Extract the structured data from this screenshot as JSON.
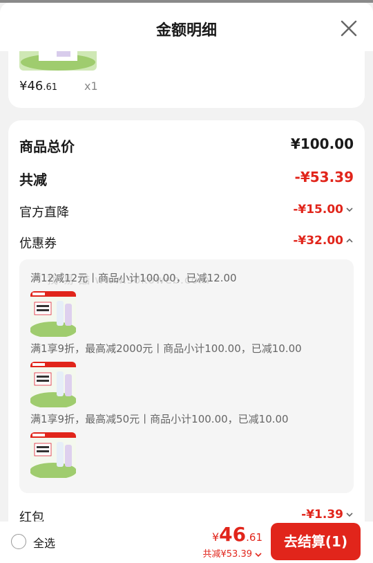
{
  "header": {
    "title": "金额明细"
  },
  "item": {
    "price_symbol": "¥",
    "price_int": "46",
    "price_dec": ".61",
    "qty": "x1"
  },
  "summary": {
    "goods_total_label": "商品总价",
    "goods_total_value": "¥100.00",
    "reduce_label": "共减",
    "reduce_value": "-¥53.39",
    "official_label": "官方直降",
    "official_value": "-¥15.00",
    "coupon_label": "优惠券",
    "coupon_value": "-¥32.00",
    "hongbao_label": "红包",
    "hongbao_value": "-¥1.39"
  },
  "coupons": [
    {
      "text": "满12减12元丨商品小计100.00，已减12.00"
    },
    {
      "text": "满1享9折，最高减2000元丨商品小计100.00，已减10.00"
    },
    {
      "text": "满1享9折，最高减50元丨商品小计100.00，已减10.00"
    }
  ],
  "watermark": "找 易 酷 www.sokoweb.com",
  "footer": {
    "select_all": "全选",
    "total_symbol": "¥",
    "total_int": "46",
    "total_dec": ".61",
    "reduced_text": "共减¥53.39",
    "checkout_label": "去结算(1)"
  },
  "colors": {
    "accent": "#e1251b",
    "background": "#f2f2f2"
  },
  "icons": {
    "close": "close-icon",
    "chevron_down": "chevron-down-icon",
    "chevron_up": "chevron-up-icon"
  }
}
